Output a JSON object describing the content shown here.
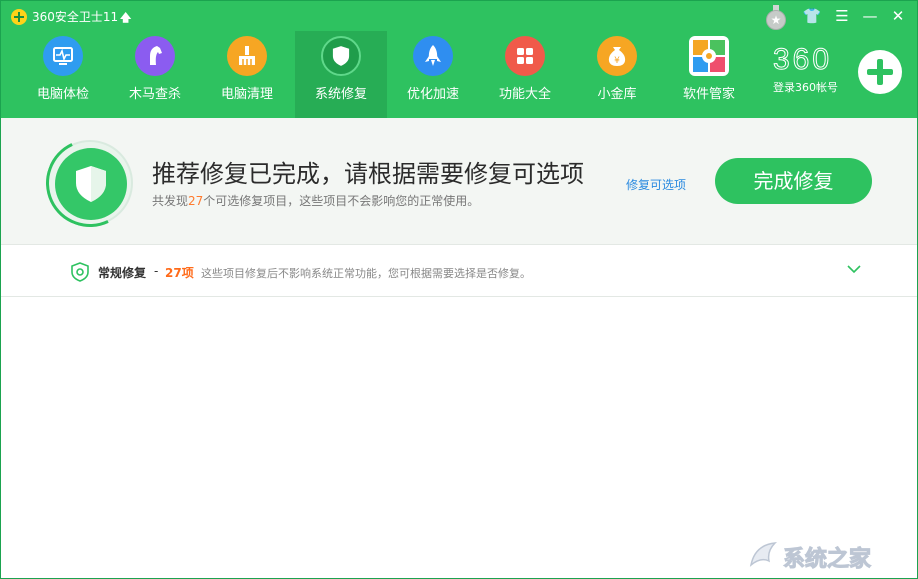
{
  "window": {
    "title": "360安全卫士11",
    "upgrade_glyph": "🡅"
  },
  "window_controls": {
    "medal": "medal-icon",
    "skin": "👕",
    "menu": "☰",
    "minimize": "—",
    "close": "✕"
  },
  "nav": {
    "items": [
      {
        "label": "电脑体检",
        "icon": "monitor-icon",
        "color": "#2f9cf0"
      },
      {
        "label": "木马查杀",
        "icon": "horse-icon",
        "color": "#8b5cf0"
      },
      {
        "label": "电脑清理",
        "icon": "broom-icon",
        "color": "#f6a623"
      },
      {
        "label": "系统修复",
        "icon": "shield-icon",
        "color": "#1f9d4b",
        "active": true
      },
      {
        "label": "优化加速",
        "icon": "rocket-icon",
        "color": "#2f8ef0"
      },
      {
        "label": "功能大全",
        "icon": "grid-icon",
        "color": "#f05a4a"
      },
      {
        "label": "小金库",
        "icon": "money-bag-icon",
        "color": "#f6a623"
      },
      {
        "label": "软件管家",
        "icon": "software-icon",
        "color": "#f0f0f0"
      }
    ]
  },
  "brand": {
    "logo_text": "360",
    "login_label": "登录360帐号"
  },
  "banner": {
    "title": "推荐修复已完成，请根据需要修复可选项",
    "desc_prefix": "共发现",
    "desc_count": "27",
    "desc_suffix": "个可选修复项目，这些项目不会影响您的正常使用。",
    "optional_link": "修复可选项",
    "finish_button": "完成修复"
  },
  "repair_section": {
    "title": "常规修复",
    "dash": "-",
    "count": "27项",
    "desc": "这些项目修复后不影响系统正常功能，您可根据需要选择是否修复。"
  },
  "watermark": {
    "text": "系统之家"
  },
  "colors": {
    "header_green": "#2ec260",
    "active_tab": "#27ad55",
    "accent_orange": "#ff7b2e",
    "link_blue": "#2a8ae0"
  }
}
